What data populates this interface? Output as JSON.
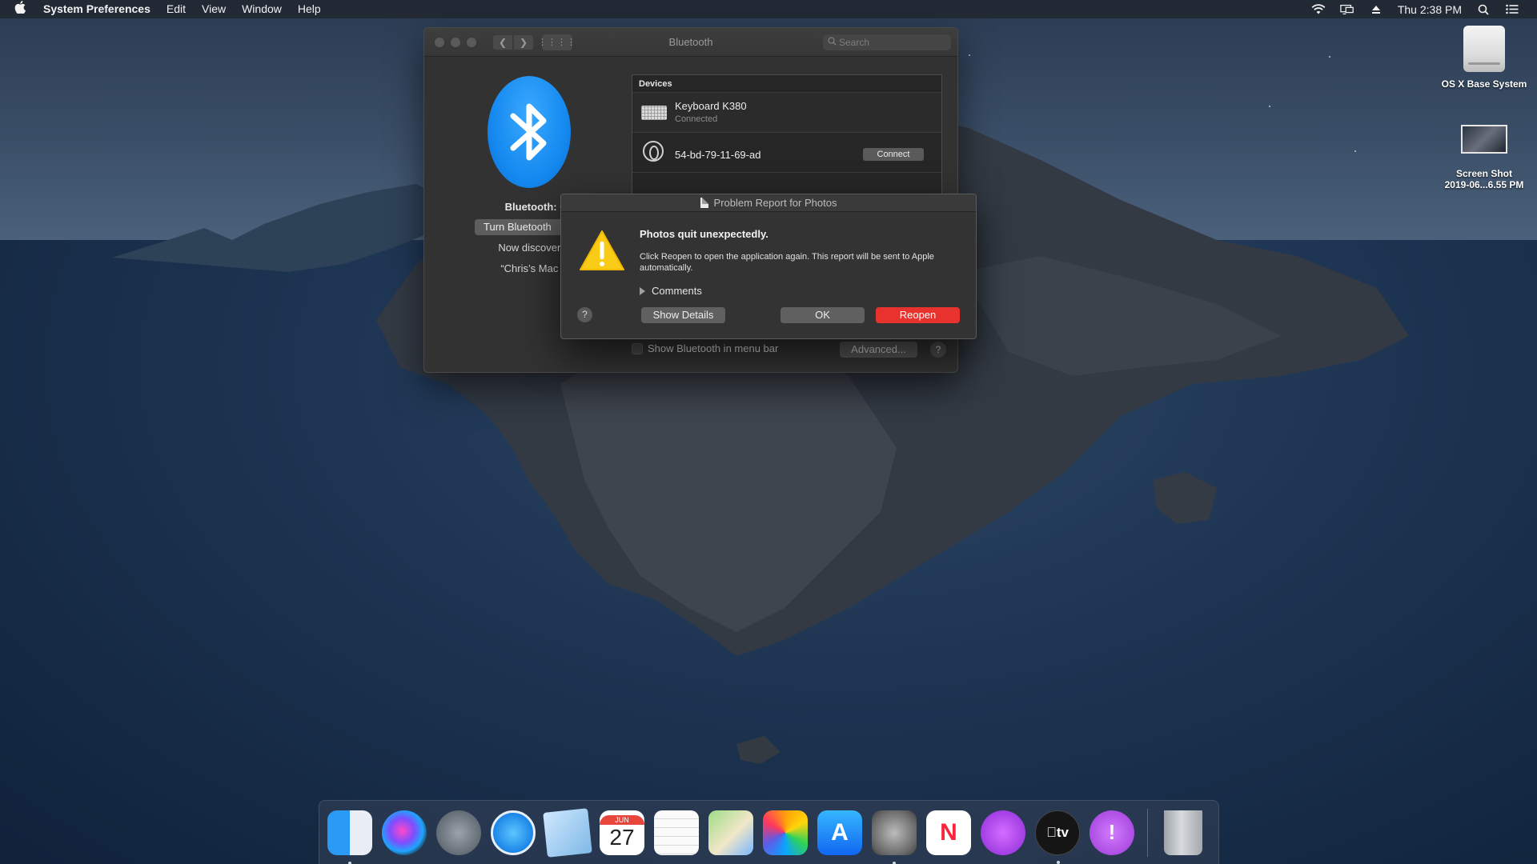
{
  "menubar": {
    "app_name": "System Preferences",
    "menus": [
      "Edit",
      "View",
      "Window",
      "Help"
    ],
    "clock": "Thu 2:38 PM"
  },
  "desktop_icons": [
    {
      "label": "OS X Base System"
    },
    {
      "label": "Screen Shot",
      "label2": "2019-06...6.55 PM"
    }
  ],
  "sysprefs": {
    "title": "Bluetooth",
    "search_placeholder": "Search",
    "bt_status": "Bluetooth: O",
    "bt_button": "Turn Bluetooth",
    "discoverable": "Now discoverabl",
    "mac_name": "“Chris’s Mac mi",
    "devices_header": "Devices",
    "devices": [
      {
        "name": "Keyboard K380",
        "status": "Connected"
      },
      {
        "name": "54-bd-79-11-69-ad",
        "action": "Connect"
      }
    ],
    "show_in_menu_bar": "Show Bluetooth in menu bar",
    "advanced": "Advanced...",
    "help": "?"
  },
  "dialog": {
    "title": "Problem Report for Photos",
    "heading": "Photos quit unexpectedly.",
    "body": "Click Reopen to open the application again. This report will be sent to Apple automatically.",
    "comments": "Comments",
    "help": "?",
    "show_details": "Show Details",
    "ok": "OK",
    "reopen": "Reopen"
  },
  "dock": {
    "calendar_month": "JUN",
    "calendar_day": "27",
    "tv_label": "tv",
    "app_store_glyph": "A",
    "news_glyph": "N",
    "feedback_glyph": "!"
  },
  "colors": {
    "accent_red": "#e8322d",
    "bluetooth_blue": "#168bf0"
  }
}
